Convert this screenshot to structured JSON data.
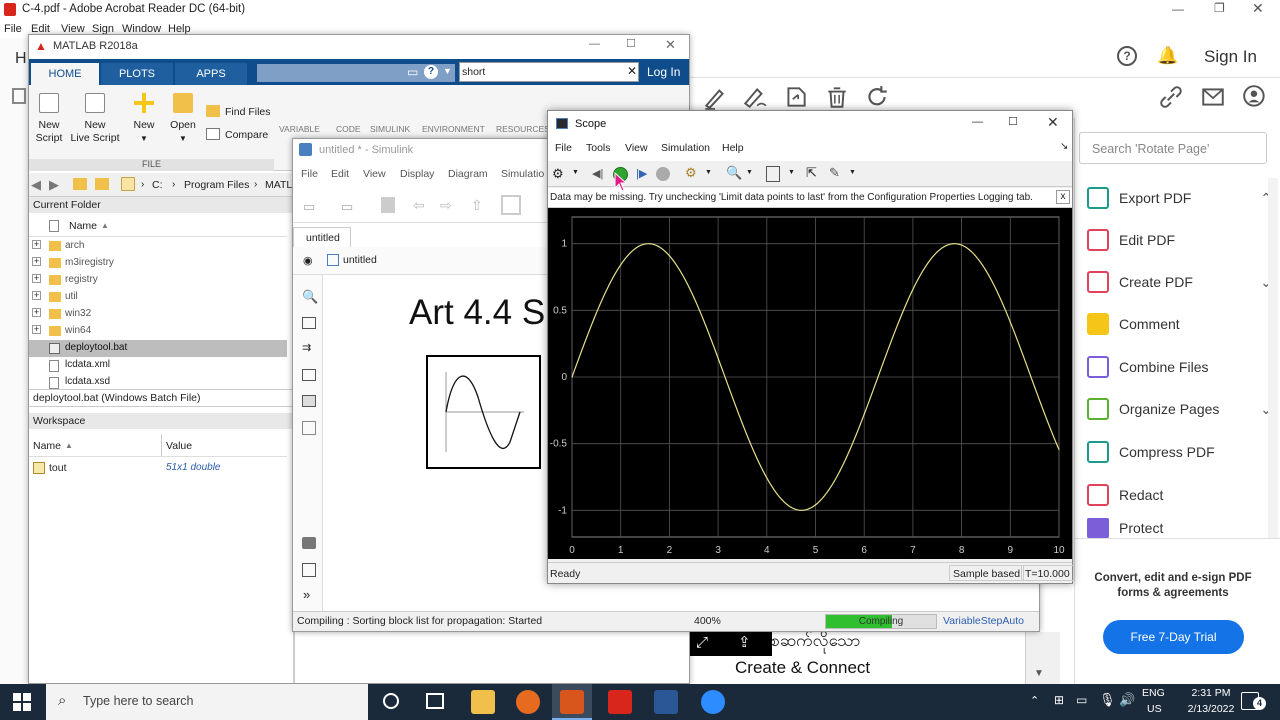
{
  "acrobat": {
    "title": "C-4.pdf - Adobe Acrobat Reader DC (64-bit)",
    "menu": [
      "File",
      "Edit",
      "View",
      "Sign",
      "Window",
      "Help"
    ],
    "sign_in": "Sign In",
    "search_placeholder": "Search 'Rotate Page'",
    "tools": [
      "Export PDF",
      "Edit PDF",
      "Create PDF",
      "Comment",
      "Combine Files",
      "Organize Pages",
      "Compress PDF",
      "Redact",
      "Protect"
    ],
    "promo": "Convert, edit and e-sign PDF forms & agreements",
    "trial_button": "Free 7-Day Trial",
    "doc_text_1": "စဆက်လိုသော",
    "doc_text_2": "Create & Connect",
    "accent": "#1473e6"
  },
  "matlab": {
    "title": "MATLAB R2018a",
    "tabs": [
      "HOME",
      "PLOTS",
      "APPS"
    ],
    "search_value": "short",
    "login": "Log In",
    "ribbon": {
      "new_script": "New\nScript",
      "new_live_script": "New\nLive Script",
      "new": "New",
      "open": "Open",
      "find_files": "Find Files",
      "compare": "Compare",
      "file_group": "FILE",
      "sections": [
        "VARIABLE",
        "CODE",
        "SIMULINK",
        "ENVIRONMENT",
        "RESOURCES"
      ]
    },
    "path": [
      "C:",
      "Program Files",
      "MATL"
    ],
    "current_folder_label": "Current Folder",
    "name_header": "Name",
    "folders": [
      "arch",
      "m3iregistry",
      "registry",
      "util",
      "win32",
      "win64"
    ],
    "files": [
      "deploytool.bat",
      "lcdata.xml",
      "lcdata.xsd"
    ],
    "details": "deploytool.bat  (Windows Batch File)",
    "workspace_label": "Workspace",
    "ws_headers": [
      "Name",
      "Value"
    ],
    "ws_rows": [
      {
        "name": "tout",
        "value": "51x1 double"
      }
    ]
  },
  "simulink": {
    "title": "untitled * - Simulink",
    "menu": [
      "File",
      "Edit",
      "View",
      "Display",
      "Diagram",
      "Simulatio"
    ],
    "tab": "untitled",
    "breadcrumb": "untitled",
    "heading": "Art 4.4 S",
    "status": "Compiling : Sorting block list for propagation: Started",
    "zoom": "400%",
    "progress_label": "Compiling",
    "progress": 0.6,
    "solver": "VariableStepAuto"
  },
  "scope": {
    "title": "Scope",
    "menu": [
      "File",
      "Tools",
      "View",
      "Simulation",
      "Help"
    ],
    "warning": "Data may be missing.  Try unchecking 'Limit data points to last' from the Configuration Properties Logging tab.",
    "status": "Ready",
    "mode": "Sample based",
    "time": "T=10.000",
    "line_color": "#e6e08a"
  },
  "chart_data": {
    "type": "line",
    "title": "",
    "xlabel": "",
    "ylabel": "",
    "xlim": [
      0,
      10
    ],
    "ylim": [
      -1.2,
      1.2
    ],
    "xticks": [
      "0",
      "1",
      "2",
      "3",
      "4",
      "5",
      "6",
      "7",
      "8",
      "9",
      "10"
    ],
    "yticks": [
      "1",
      "0.5",
      "0",
      "-0.5",
      "-1"
    ],
    "grid": true,
    "series": [
      {
        "x": [
          0,
          0.5,
          1,
          1.5,
          2,
          2.5,
          3,
          3.5,
          4,
          4.5,
          5,
          5.5,
          6,
          6.5,
          7,
          7.5,
          8,
          8.5,
          9,
          9.5,
          10
        ],
        "y": [
          0,
          0.479,
          0.841,
          0.997,
          0.909,
          0.598,
          0.141,
          -0.351,
          -0.757,
          -0.978,
          -0.959,
          -0.706,
          -0.279,
          0.215,
          0.657,
          0.938,
          0.989,
          0.798,
          0.412,
          -0.075,
          -0.544
        ]
      }
    ]
  },
  "taskbar": {
    "search_placeholder": "Type here to search",
    "lang": "ENG",
    "region": "US",
    "time": "2:31 PM",
    "date": "2/13/2022",
    "notifications": "4"
  }
}
